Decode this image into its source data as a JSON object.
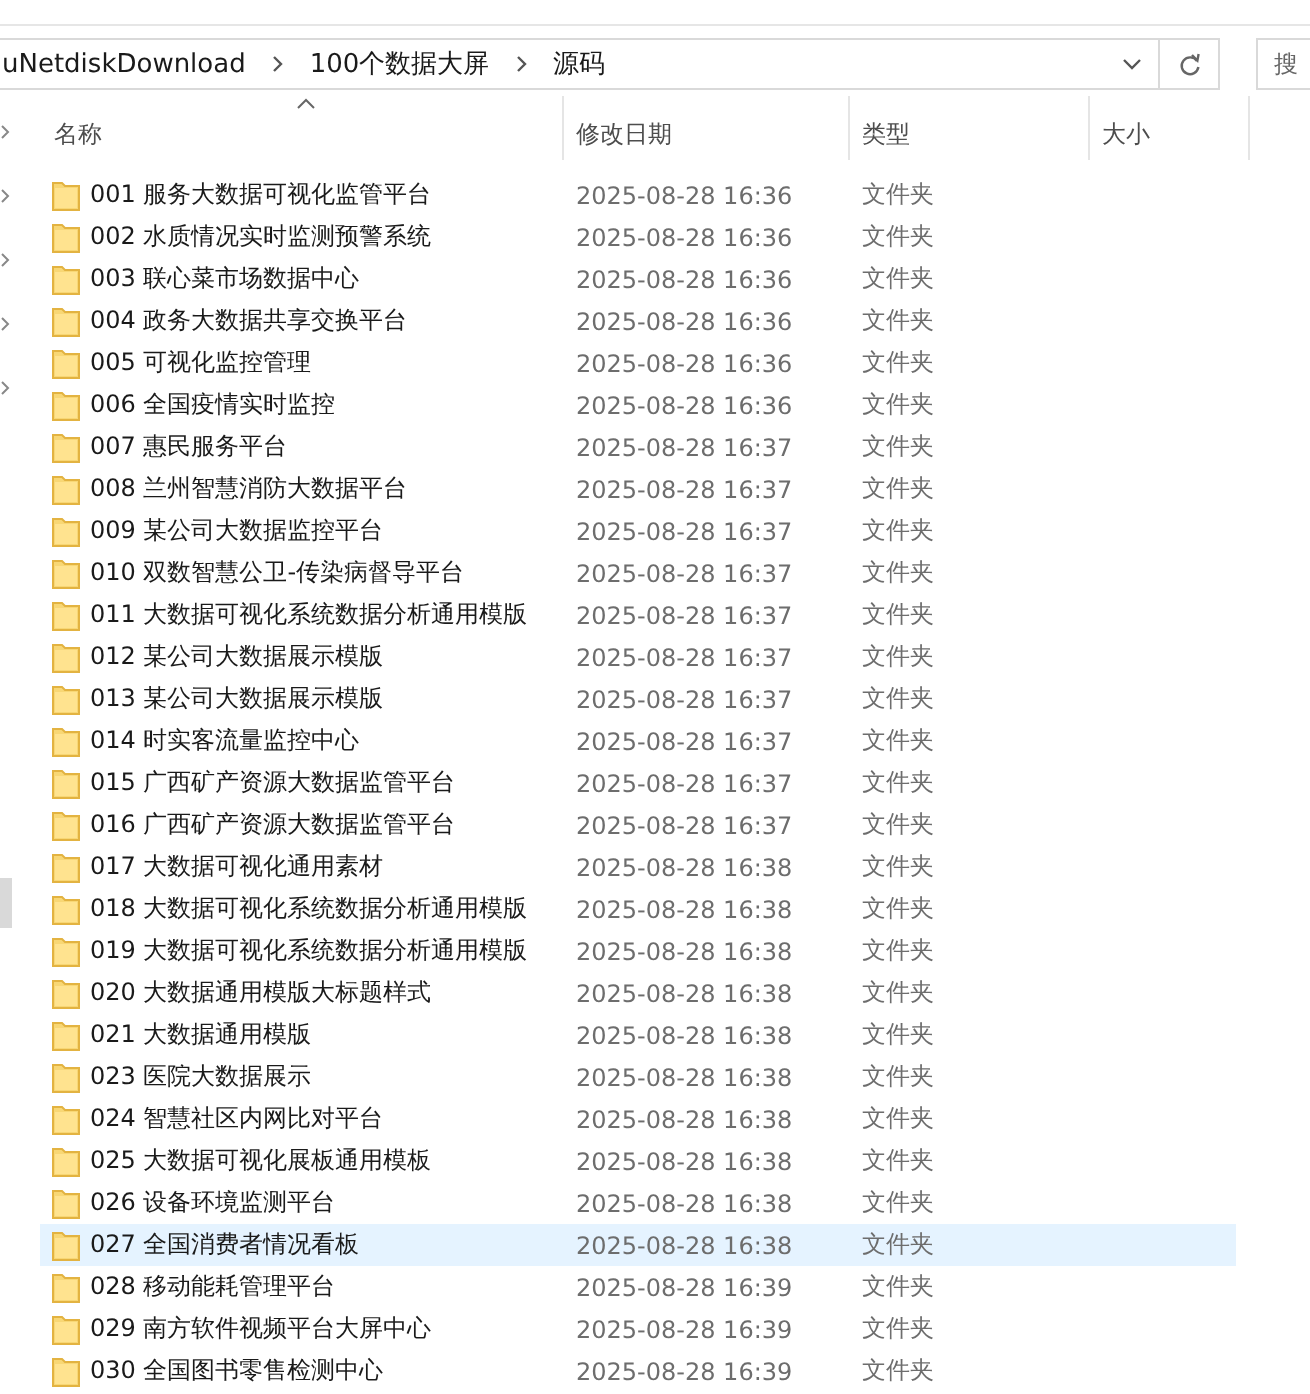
{
  "address_bar": {
    "path": [
      "uNetdiskDownload",
      "100个数据大屏",
      "源码"
    ]
  },
  "search": {
    "placeholder": "搜"
  },
  "columns": [
    {
      "label": "名称",
      "sorted": true
    },
    {
      "label": "修改日期",
      "sorted": false
    },
    {
      "label": "类型",
      "sorted": false
    },
    {
      "label": "大小",
      "sorted": false
    }
  ],
  "rows": [
    {
      "name": "001 服务大数据可视化监管平台",
      "date": "2025-08-28 16:36",
      "type": "文件夹",
      "selected": false
    },
    {
      "name": "002 水质情况实时监测预警系统",
      "date": "2025-08-28 16:36",
      "type": "文件夹",
      "selected": false
    },
    {
      "name": "003 联心菜市场数据中心",
      "date": "2025-08-28 16:36",
      "type": "文件夹",
      "selected": false
    },
    {
      "name": "004 政务大数据共享交换平台",
      "date": "2025-08-28 16:36",
      "type": "文件夹",
      "selected": false
    },
    {
      "name": "005 可视化监控管理",
      "date": "2025-08-28 16:36",
      "type": "文件夹",
      "selected": false
    },
    {
      "name": "006 全国疫情实时监控",
      "date": "2025-08-28 16:36",
      "type": "文件夹",
      "selected": false
    },
    {
      "name": "007 惠民服务平台",
      "date": "2025-08-28 16:37",
      "type": "文件夹",
      "selected": false
    },
    {
      "name": "008 兰州智慧消防大数据平台",
      "date": "2025-08-28 16:37",
      "type": "文件夹",
      "selected": false
    },
    {
      "name": "009 某公司大数据监控平台",
      "date": "2025-08-28 16:37",
      "type": "文件夹",
      "selected": false
    },
    {
      "name": "010 双数智慧公卫-传染病督导平台",
      "date": "2025-08-28 16:37",
      "type": "文件夹",
      "selected": false
    },
    {
      "name": "011 大数据可视化系统数据分析通用模版",
      "date": "2025-08-28 16:37",
      "type": "文件夹",
      "selected": false
    },
    {
      "name": "012 某公司大数据展示模版",
      "date": "2025-08-28 16:37",
      "type": "文件夹",
      "selected": false
    },
    {
      "name": "013 某公司大数据展示模版",
      "date": "2025-08-28 16:37",
      "type": "文件夹",
      "selected": false
    },
    {
      "name": "014 时实客流量监控中心",
      "date": "2025-08-28 16:37",
      "type": "文件夹",
      "selected": false
    },
    {
      "name": "015 广西矿产资源大数据监管平台",
      "date": "2025-08-28 16:37",
      "type": "文件夹",
      "selected": false
    },
    {
      "name": "016 广西矿产资源大数据监管平台",
      "date": "2025-08-28 16:37",
      "type": "文件夹",
      "selected": false
    },
    {
      "name": "017 大数据可视化通用素材",
      "date": "2025-08-28 16:38",
      "type": "文件夹",
      "selected": false
    },
    {
      "name": "018 大数据可视化系统数据分析通用模版",
      "date": "2025-08-28 16:38",
      "type": "文件夹",
      "selected": false
    },
    {
      "name": "019 大数据可视化系统数据分析通用模版",
      "date": "2025-08-28 16:38",
      "type": "文件夹",
      "selected": false
    },
    {
      "name": "020 大数据通用模版大标题样式",
      "date": "2025-08-28 16:38",
      "type": "文件夹",
      "selected": false
    },
    {
      "name": "021 大数据通用模版",
      "date": "2025-08-28 16:38",
      "type": "文件夹",
      "selected": false
    },
    {
      "name": "023 医院大数据展示",
      "date": "2025-08-28 16:38",
      "type": "文件夹",
      "selected": false
    },
    {
      "name": "024 智慧社区内网比对平台",
      "date": "2025-08-28 16:38",
      "type": "文件夹",
      "selected": false
    },
    {
      "name": "025 大数据可视化展板通用模板",
      "date": "2025-08-28 16:38",
      "type": "文件夹",
      "selected": false
    },
    {
      "name": "026 设备环境监测平台",
      "date": "2025-08-28 16:38",
      "type": "文件夹",
      "selected": false
    },
    {
      "name": "027 全国消费者情况看板",
      "date": "2025-08-28 16:38",
      "type": "文件夹",
      "selected": true
    },
    {
      "name": "028 移动能耗管理平台",
      "date": "2025-08-28 16:39",
      "type": "文件夹",
      "selected": false
    },
    {
      "name": "029 南方软件视频平台大屏中心",
      "date": "2025-08-28 16:39",
      "type": "文件夹",
      "selected": false
    },
    {
      "name": "030 全国图书零售检测中心",
      "date": "2025-08-28 16:39",
      "type": "文件夹",
      "selected": false
    }
  ]
}
